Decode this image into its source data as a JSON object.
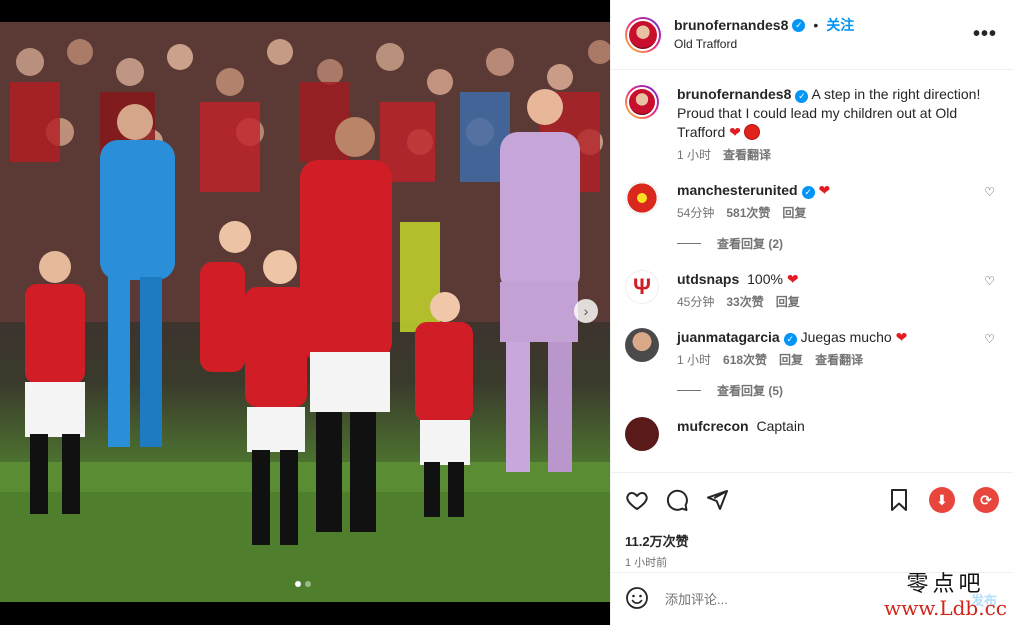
{
  "post": {
    "username": "brunofernandes8",
    "verified": true,
    "dot": "•",
    "follow_label": "关注",
    "location": "Old Trafford",
    "more_label": "•••"
  },
  "caption": {
    "username": "brunofernandes8",
    "text": "A step in the right direction! Proud that I could lead my children out at Old Trafford",
    "time": "1 小时",
    "translate": "查看翻译"
  },
  "comments": [
    {
      "username": "manchesterunited",
      "verified": true,
      "text": "",
      "time": "54分钟",
      "likes": "581次赞",
      "reply": "回复",
      "view_replies": "查看回复 (2)"
    },
    {
      "username": "utdsnaps",
      "verified": false,
      "text": "100%",
      "time": "45分钟",
      "likes": "33次赞",
      "reply": "回复"
    },
    {
      "username": "juanmatagarcia",
      "verified": true,
      "text": "Juegas mucho",
      "time": "1 小时",
      "likes": "618次赞",
      "reply": "回复",
      "translate": "查看翻译",
      "view_replies": "查看回复 (5)"
    },
    {
      "username": "mufcrecon",
      "verified": false,
      "text": "Captain"
    }
  ],
  "stats": {
    "likes": "11.2万次赞",
    "time_ago": "1 小时前"
  },
  "composer": {
    "placeholder": "添加评论...",
    "post_label": "发布"
  },
  "watermark": {
    "chinese": "零点吧",
    "url": "www.Ldb.cc"
  },
  "colors": {
    "accent": "#0095f6",
    "heart": "#e31b23",
    "download": "#e8453c"
  },
  "icons": {
    "like": "heart-outline-icon",
    "comment": "comment-bubble-icon",
    "share": "paper-plane-icon",
    "save": "bookmark-icon",
    "download": "download-icon",
    "repost": "repost-icon",
    "emoji": "smiley-icon",
    "next": "chevron-right-icon"
  },
  "carousel": {
    "current": 1,
    "total": 2
  }
}
